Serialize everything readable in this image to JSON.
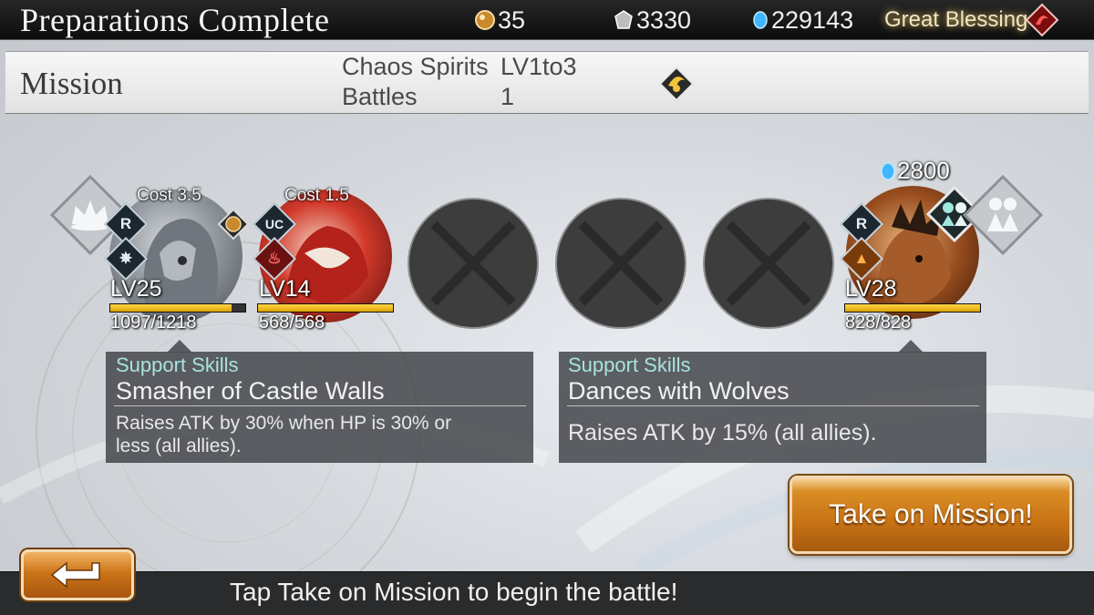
{
  "header": {
    "title": "Preparations Complete",
    "resources": [
      {
        "name": "stamina-orb",
        "value": "35"
      },
      {
        "name": "gil",
        "value": "3330"
      },
      {
        "name": "gems",
        "value": "229143"
      }
    ],
    "blessing_label": "Great Blessing"
  },
  "mission": {
    "label": "Mission",
    "name_key": "Chaos Spirits",
    "name_value": "LV1to3",
    "battles_key": "Battles",
    "battles_value": "1"
  },
  "party": [
    {
      "cost": "Cost 3.5",
      "rarity": "R",
      "level": "LV25",
      "hp": "1097/1218",
      "hp_fraction": 0.9,
      "icon": "armored-knight-portrait"
    },
    {
      "cost": "Cost 1.5",
      "rarity": "UC",
      "level": "LV14",
      "hp": "568/568",
      "hp_fraction": 1.0,
      "icon": "red-beast-portrait"
    },
    {
      "empty": true
    },
    {
      "empty": true
    },
    {
      "empty": true
    }
  ],
  "friend": {
    "gem_cost": "2800",
    "rarity": "R",
    "level": "LV28",
    "hp": "828/828",
    "hp_fraction": 1.0,
    "icon": "wild-warrior-portrait"
  },
  "skills": [
    {
      "header": "Support Skills",
      "name": "Smasher of Castle Walls",
      "description": "Raises ATK by 30% when HP is 30% or less (all allies)."
    },
    {
      "header": "Support Skills",
      "name": "Dances with Wolves",
      "description": "Raises ATK by 15% (all allies)."
    }
  ],
  "buttons": {
    "take_mission": "Take on Mission!"
  },
  "footer": {
    "hint": "Tap Take on Mission to begin the battle!"
  },
  "colors": {
    "accent_orange": "#c87316",
    "hp_yellow": "#ffd54a",
    "panel": "#484a4e",
    "skill_header": "#a8e3e0"
  }
}
